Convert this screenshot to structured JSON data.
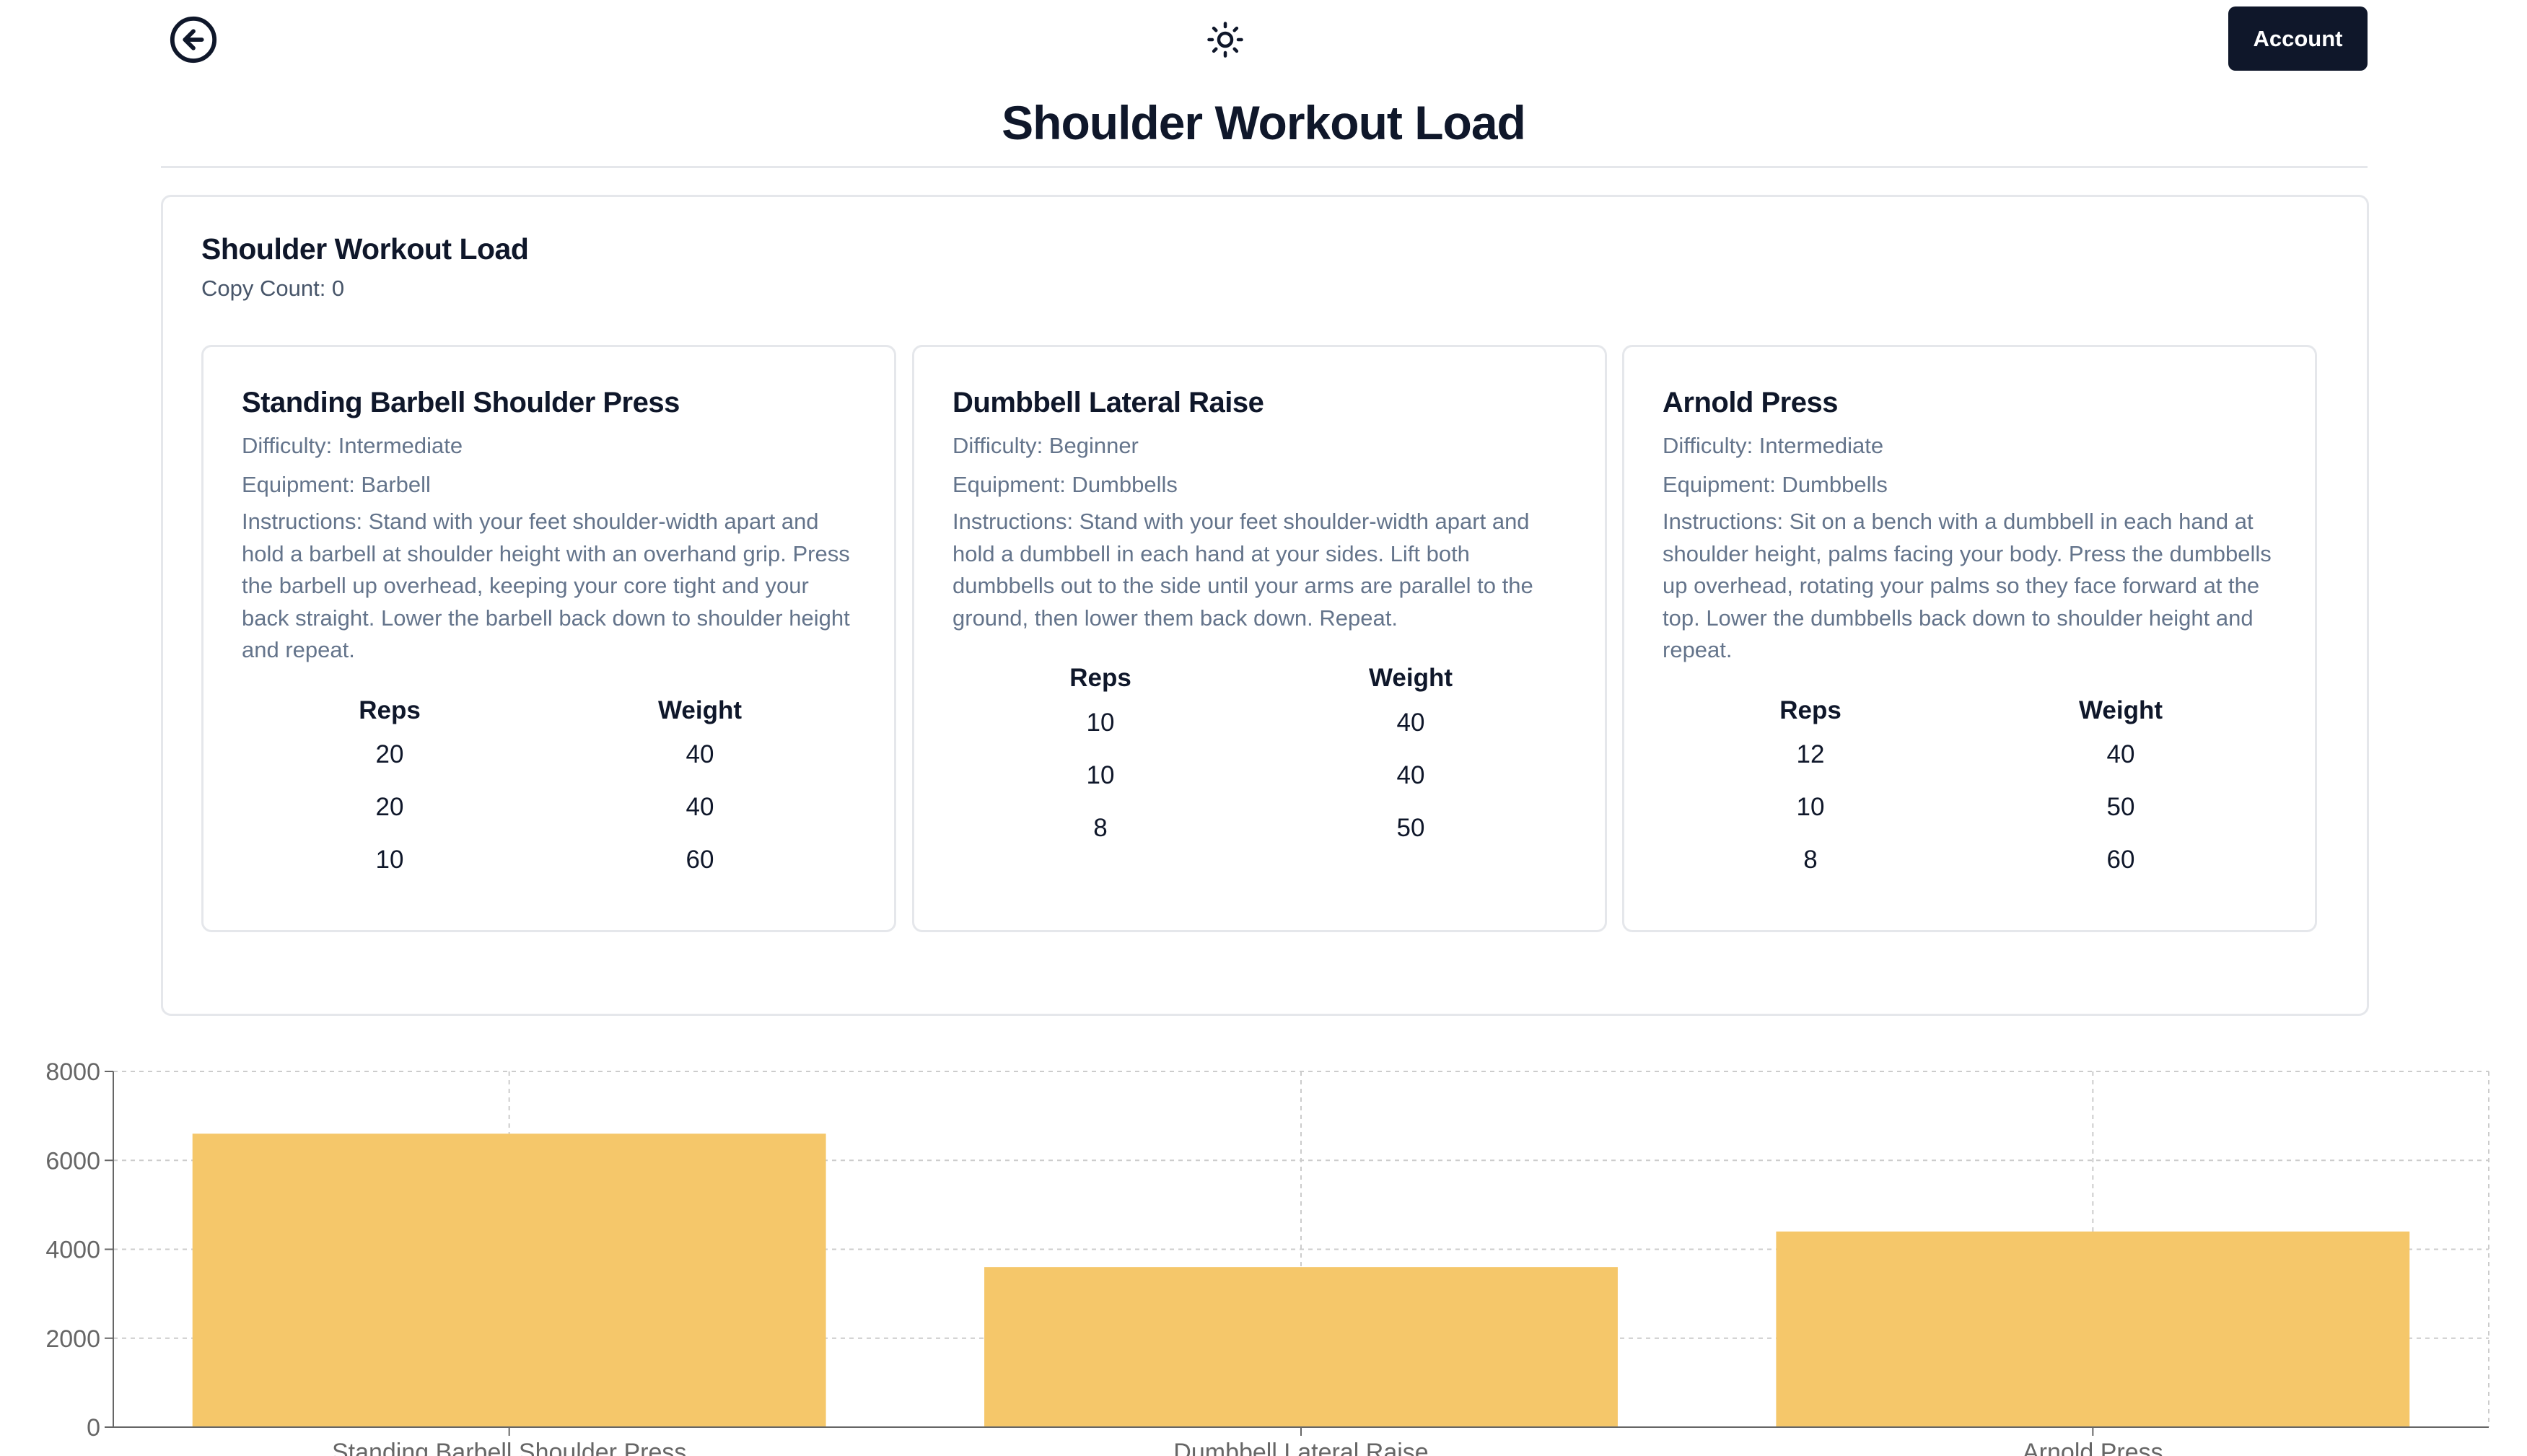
{
  "header": {
    "back_icon": "arrow-left-circle-icon",
    "theme_icon": "sun-icon",
    "account_label": "Account",
    "page_title": "Shoulder Workout Load"
  },
  "workout": {
    "title": "Shoulder Workout Load",
    "copy_count": "Copy Count: 0",
    "sets_headers": {
      "reps": "Reps",
      "weight": "Weight"
    },
    "exercises": [
      {
        "name": "Standing Barbell Shoulder Press",
        "difficulty": "Difficulty: Intermediate",
        "equipment": "Equipment: Barbell",
        "instructions": "Instructions: Stand with your feet shoulder-width apart and hold a barbell at shoulder height with an overhand grip. Press the barbell up overhead, keeping your core tight and your back straight. Lower the barbell back down to shoulder height and repeat.",
        "sets": [
          {
            "reps": "20",
            "weight": "40"
          },
          {
            "reps": "20",
            "weight": "40"
          },
          {
            "reps": "10",
            "weight": "60"
          }
        ]
      },
      {
        "name": "Dumbbell Lateral Raise",
        "difficulty": "Difficulty: Beginner",
        "equipment": "Equipment: Dumbbells",
        "instructions": "Instructions: Stand with your feet shoulder-width apart and hold a dumbbell in each hand at your sides. Lift both dumbbells out to the side until your arms are parallel to the ground, then lower them back down. Repeat.",
        "sets": [
          {
            "reps": "10",
            "weight": "40"
          },
          {
            "reps": "10",
            "weight": "40"
          },
          {
            "reps": "8",
            "weight": "50"
          }
        ]
      },
      {
        "name": "Arnold Press",
        "difficulty": "Difficulty: Intermediate",
        "equipment": "Equipment: Dumbbells",
        "instructions": "Instructions: Sit on a bench with a dumbbell in each hand at shoulder height, palms facing your body. Press the dumbbells up overhead, rotating your palms so they face forward at the top. Lower the dumbbells back down to shoulder height and repeat.",
        "sets": [
          {
            "reps": "12",
            "weight": "40"
          },
          {
            "reps": "10",
            "weight": "50"
          },
          {
            "reps": "8",
            "weight": "60"
          }
        ]
      }
    ]
  },
  "chart_data": {
    "type": "bar",
    "categories": [
      "Standing Barbell Shoulder Press",
      "Dumbbell Lateral Raise",
      "Arnold Press"
    ],
    "values": [
      6600,
      3600,
      4400
    ],
    "ylim": [
      0,
      8000
    ],
    "yticks": [
      0,
      2000,
      4000,
      6000,
      8000
    ],
    "grid": true,
    "bar_color": "#f5c76a"
  }
}
